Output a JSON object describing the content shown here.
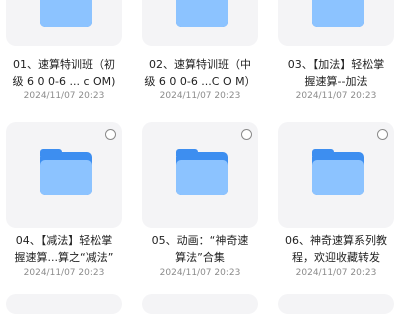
{
  "files": [
    {
      "line1": "01、速算特训班（初",
      "line2": "级 6 0 0-6 ... c OM)",
      "date": "2024/11/07 20:23"
    },
    {
      "line1": "02、速算特训班（中",
      "line2": "级 6 0 0-6 ...C O M）",
      "date": "2024/11/07 20:23"
    },
    {
      "line1": "03、【加法】轻松掌",
      "line2": "握速算--加法",
      "date": "2024/11/07 20:23"
    },
    {
      "line1": "04、【减法】轻松掌",
      "line2": "握速算...算之“减法”",
      "date": "2024/11/07 20:23"
    },
    {
      "line1": "05、动画：“神奇速",
      "line2": "算法”合集",
      "date": "2024/11/07 20:23"
    },
    {
      "line1": "06、神奇速算系列教",
      "line2": "程，欢迎收藏转发",
      "date": "2024/11/07 20:23"
    }
  ],
  "colors": {
    "folder_back": "#3d8ef0",
    "folder_front": "#8cc3ff",
    "tile_bg": "#f4f4f6"
  },
  "icons": {
    "folder": "folder-icon",
    "select": "select-circle-icon"
  }
}
